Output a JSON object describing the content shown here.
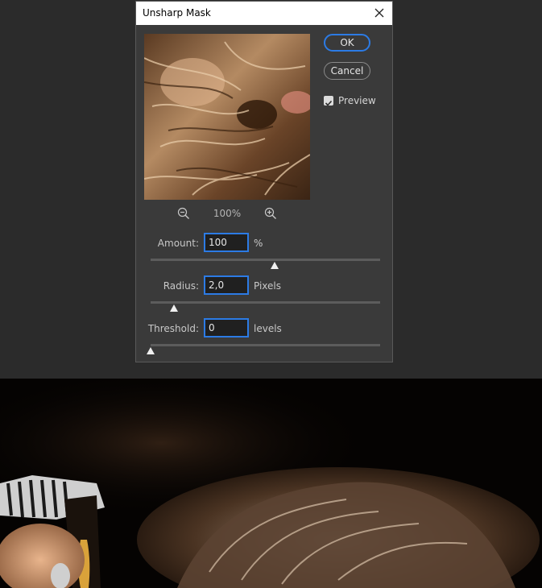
{
  "dialog": {
    "title": "Unsharp Mask",
    "ok_label": "OK",
    "cancel_label": "Cancel",
    "preview_label": "Preview",
    "preview_checked": true,
    "zoom_level": "100%"
  },
  "fields": {
    "amount": {
      "label": "Amount:",
      "value": "100",
      "unit": "%",
      "slider_fraction": 0.54
    },
    "radius": {
      "label": "Radius:",
      "value": "2,0",
      "unit": "Pixels",
      "slider_fraction": 0.1
    },
    "threshold": {
      "label": "Threshold:",
      "value": "0",
      "unit": "levels",
      "slider_fraction": 0.0
    }
  },
  "icons": {
    "close": "close-icon",
    "zoom_out": "zoom-out-icon",
    "zoom_in": "zoom-in-icon",
    "checkbox": "checkmark-icon"
  },
  "colors": {
    "accent": "#2c7be5",
    "dialog_bg": "#3a3a3a",
    "workspace_bg": "#2b2b2b"
  }
}
